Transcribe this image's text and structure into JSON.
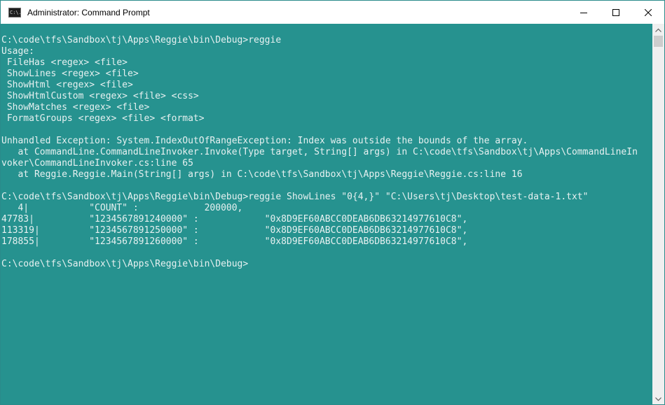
{
  "window": {
    "title": "Administrator: Command Prompt",
    "icon_glyph": "C:\\."
  },
  "icons": {
    "app": "command-prompt-icon",
    "minimize": "minimize-icon",
    "maximize": "maximize-icon",
    "close": "close-icon"
  },
  "colors": {
    "console_background": "#26928f",
    "console_text": "#e7f1f1"
  },
  "console": {
    "lines": [
      "C:\\code\\tfs\\Sandbox\\tj\\Apps\\Reggie\\bin\\Debug>reggie",
      "Usage:",
      " FileHas <regex> <file>",
      " ShowLines <regex> <file>",
      " ShowHtml <regex> <file>",
      " ShowHtmlCustom <regex> <file> <css>",
      " ShowMatches <regex> <file>",
      " FormatGroups <regex> <file> <format>",
      "",
      "Unhandled Exception: System.IndexOutOfRangeException: Index was outside the bounds of the array.",
      "   at CommandLine.CommandLineInvoker.Invoke(Type target, String[] args) in C:\\code\\tfs\\Sandbox\\tj\\Apps\\CommandLineIn",
      "voker\\CommandLineInvoker.cs:line 65",
      "   at Reggie.Reggie.Main(String[] args) in C:\\code\\tfs\\Sandbox\\tj\\Apps\\Reggie\\Reggie.cs:line 16",
      "",
      "C:\\code\\tfs\\Sandbox\\tj\\Apps\\Reggie\\bin\\Debug>reggie ShowLines \"0{4,}\" \"C:\\Users\\tj\\Desktop\\test-data-1.txt\"",
      "   4|           \"COUNT\" :            200000,",
      "47783|          \"1234567891240000\" :            \"0x8D9EF60ABCC0DEAB6DB63214977610C8\",",
      "113319|         \"1234567891250000\" :            \"0x8D9EF60ABCC0DEAB6DB63214977610C8\",",
      "178855|         \"1234567891260000\" :            \"0x8D9EF60ABCC0DEAB6DB63214977610C8\",",
      "",
      "C:\\code\\tfs\\Sandbox\\tj\\Apps\\Reggie\\bin\\Debug>"
    ]
  }
}
